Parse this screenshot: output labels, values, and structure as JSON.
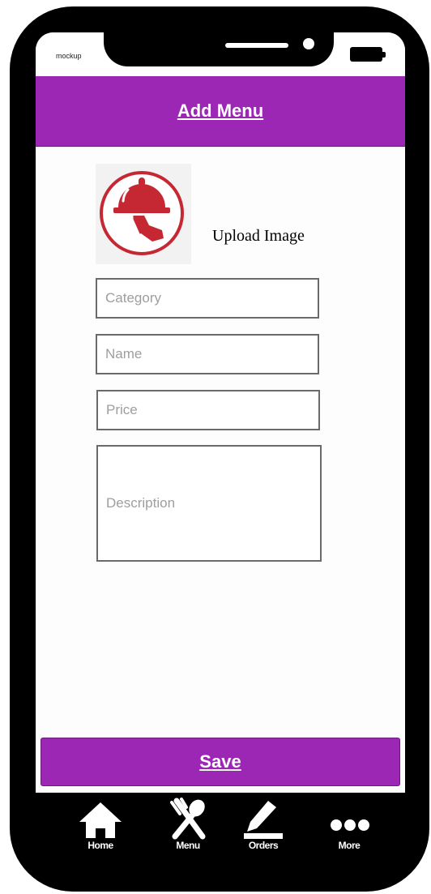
{
  "status_bar": {
    "carrier": "mockup"
  },
  "header": {
    "title": "Add Menu"
  },
  "upload": {
    "icon": "food-service-cloche-icon",
    "label": "Upload Image"
  },
  "form": {
    "category_placeholder": "Category",
    "name_placeholder": "Name",
    "price_placeholder": "Price",
    "description_placeholder": "Description"
  },
  "actions": {
    "save_label": "Save"
  },
  "bottom_nav": {
    "items": [
      {
        "label": "Home",
        "icon": "home-icon"
      },
      {
        "label": "Menu",
        "icon": "fork-spoon-icon"
      },
      {
        "label": "Orders",
        "icon": "pencil-icon"
      },
      {
        "label": "More",
        "icon": "more-dots-icon"
      }
    ]
  },
  "colors": {
    "accent": "#9c27b4",
    "logo_red": "#c62833",
    "phone_frame": "#000000"
  }
}
